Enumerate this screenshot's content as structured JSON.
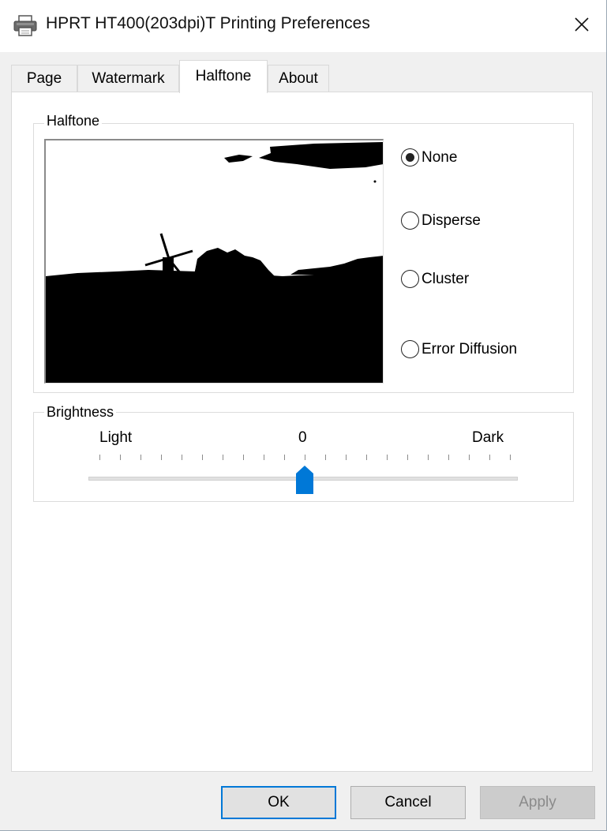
{
  "window": {
    "title": "HPRT HT400(203dpi)T Printing Preferences",
    "icon": "printer-icon",
    "close_icon": "close-icon"
  },
  "tabs": [
    {
      "label": "Page",
      "active": false
    },
    {
      "label": "Watermark",
      "active": false
    },
    {
      "label": "Halftone",
      "active": true
    },
    {
      "label": "About",
      "active": false
    }
  ],
  "halftone": {
    "group_label": "Halftone",
    "preview_image": "windmill-landscape-preview",
    "options": [
      {
        "label": "None",
        "selected": true
      },
      {
        "label": "Disperse",
        "selected": false
      },
      {
        "label": "Cluster",
        "selected": false
      },
      {
        "label": "Error Diffusion",
        "selected": false
      }
    ]
  },
  "brightness": {
    "group_label": "Brightness",
    "min_label": "Light",
    "value_label": "0",
    "max_label": "Dark",
    "value_fraction": 0.5,
    "tick_count": 20,
    "accent": "#0078d7"
  },
  "buttons": {
    "ok": "OK",
    "cancel": "Cancel",
    "apply": "Apply"
  }
}
